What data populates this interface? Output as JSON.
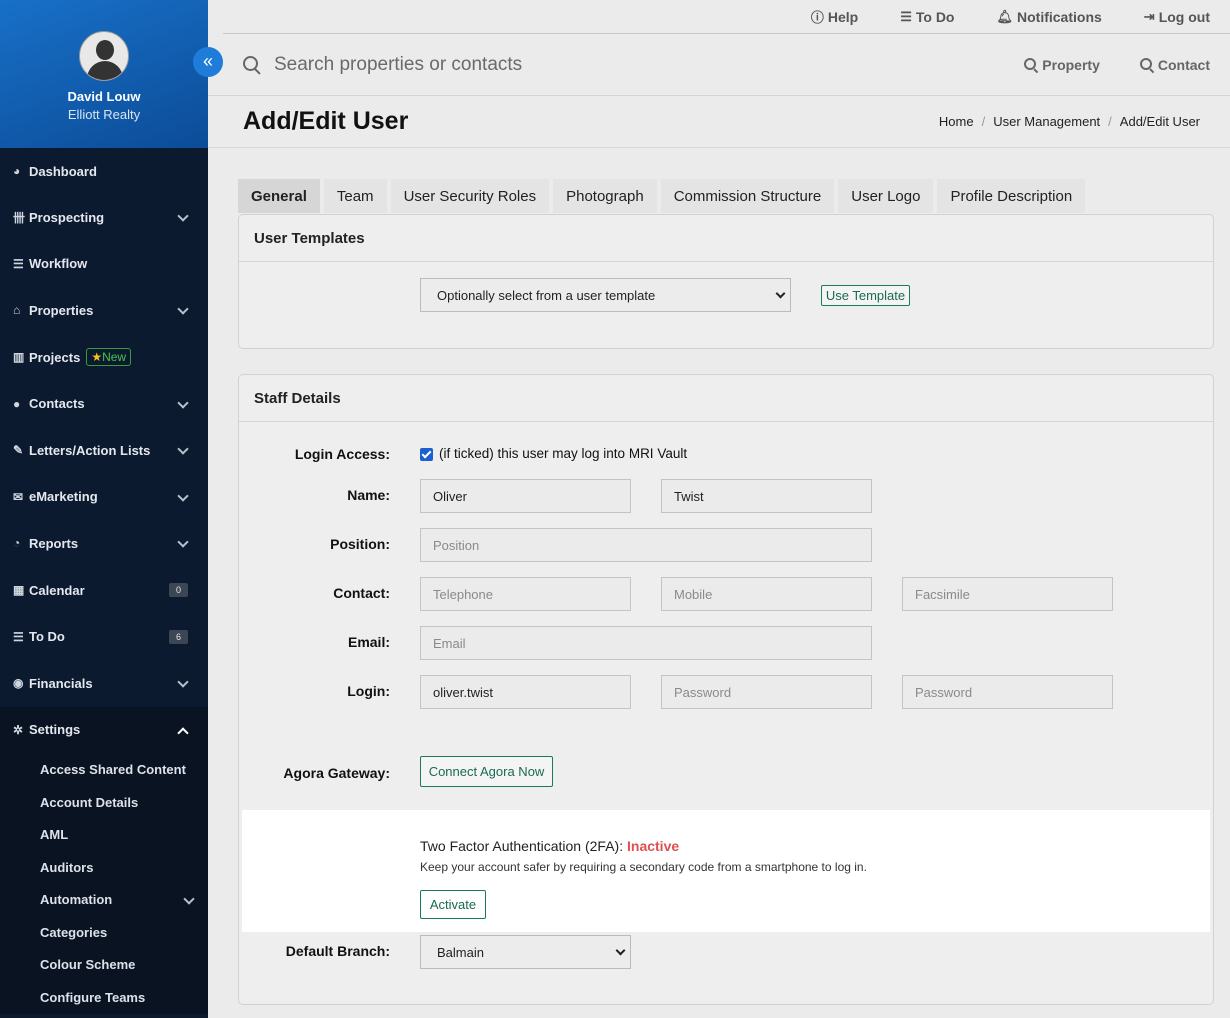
{
  "user": {
    "name": "David Louw",
    "company": "Elliott Realty"
  },
  "sidebar": {
    "collapse_icon": "«",
    "items": [
      {
        "label": "Dashboard",
        "icon": "◕"
      },
      {
        "label": "Prospecting",
        "icon": "卌"
      },
      {
        "label": "Workflow",
        "icon": "☰"
      },
      {
        "label": "Properties",
        "icon": "⌂"
      },
      {
        "label": "Projects",
        "icon": "▥",
        "tag": "New"
      },
      {
        "label": "Contacts",
        "icon": "●"
      },
      {
        "label": "Letters/Action Lists",
        "icon": "✎"
      },
      {
        "label": "eMarketing",
        "icon": "✉"
      },
      {
        "label": "Reports",
        "icon": "◔"
      },
      {
        "label": "Calendar",
        "icon": "▦",
        "badge": "0"
      },
      {
        "label": "To Do",
        "icon": "☰",
        "badge": "6"
      },
      {
        "label": "Financials",
        "icon": "◉"
      },
      {
        "label": "Settings",
        "icon": "✲"
      }
    ],
    "settings_sub": [
      {
        "label": "Access Shared Content"
      },
      {
        "label": "Account Details"
      },
      {
        "label": "AML"
      },
      {
        "label": "Auditors"
      },
      {
        "label": "Automation"
      },
      {
        "label": "Categories"
      },
      {
        "label": "Colour Scheme"
      },
      {
        "label": "Configure Teams"
      }
    ]
  },
  "topbar": {
    "help": "Help",
    "todo": "To Do",
    "notifications": "Notifications",
    "logout": "Log out"
  },
  "search": {
    "placeholder": "Search properties or contacts",
    "property": "Property",
    "contact": "Contact"
  },
  "page": {
    "title": "Add/Edit User",
    "breadcrumb": [
      "Home",
      "User Management",
      "Add/Edit User"
    ]
  },
  "tabs": [
    "General",
    "Team",
    "User Security Roles",
    "Photograph",
    "Commission Structure",
    "User Logo",
    "Profile Description"
  ],
  "templates": {
    "heading": "User Templates",
    "select_value": "Optionally select from a user template",
    "button": "Use Template"
  },
  "staff": {
    "heading": "Staff Details",
    "login_access_label": "Login Access:",
    "login_access_text": "(if ticked) this user may log into MRI Vault",
    "name_label": "Name:",
    "first_name": "Oliver",
    "last_name": "Twist",
    "position_label": "Position:",
    "position_ph": "Position",
    "contact_label": "Contact:",
    "telephone_ph": "Telephone",
    "mobile_ph": "Mobile",
    "fax_ph": "Facsimile",
    "email_label": "Email:",
    "email_ph": "Email",
    "login_label": "Login:",
    "login_value": "oliver.twist",
    "password_ph": "Password",
    "password2_ph": "Password",
    "agora_label": "Agora Gateway:",
    "agora_button": "Connect Agora Now",
    "tfa_title": "Two Factor Authentication (2FA):",
    "tfa_status": "Inactive",
    "tfa_desc": "Keep your account safer by requiring a secondary code from a smartphone to log in.",
    "tfa_button": "Activate",
    "branch_label": "Default Branch:",
    "branch_value": "Balmain"
  }
}
